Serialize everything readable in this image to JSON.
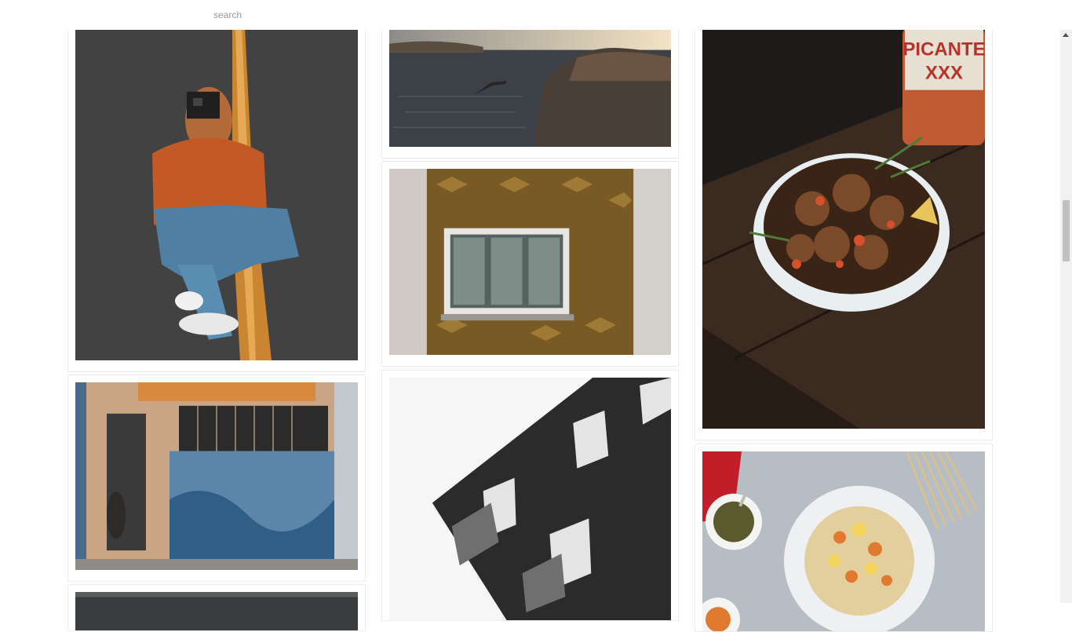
{
  "search": {
    "placeholder": "search"
  },
  "gallery": {
    "photos": [
      {
        "alt": "woman-with-instant-camera-on-road"
      },
      {
        "alt": "graffiti-storefront"
      },
      {
        "alt": "diver-at-lake-sunset"
      },
      {
        "alt": "window-on-tiled-facade"
      },
      {
        "alt": "building-balconies"
      },
      {
        "alt": "meatballs-bowl",
        "label_line1": "PICANTE",
        "label_line2": "XXX"
      },
      {
        "alt": "pasta-plate"
      }
    ]
  },
  "colors": {
    "background": "#ffffff",
    "card_border": "#ececec",
    "scrollbar_thumb": "#c1c1c1"
  }
}
